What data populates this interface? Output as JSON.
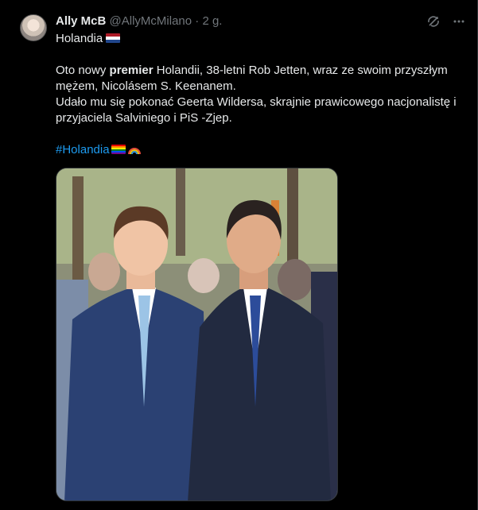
{
  "post": {
    "author_name": "Ally McB",
    "author_handle": "@AllyMcMilano",
    "time": "· 2 g.",
    "title": "Holandia",
    "line1_pre": "Oto nowy ",
    "line1_bold": "premier",
    "line1_post": " Holandii, 38-letni Rob Jetten, wraz ze swoim przyszłym mężem, Nicolásem S. Keenanem.",
    "line2": "Udało mu się pokonać Geerta Wildersa, skrajnie prawicowego nacjonalistę i przyjaciela Salviniego i PiS -Zjep.",
    "hashtag": "#Holandia"
  },
  "icons": {
    "avatar": "avatar",
    "grok": "grok-icon",
    "more": "more-icon",
    "flag_netherlands": "netherlands-flag-icon",
    "flag_rainbow": "rainbow-flag-icon",
    "rainbow": "rainbow-icon"
  },
  "colors": {
    "background": "#000000",
    "text": "#e7e9ea",
    "muted": "#71767b",
    "link": "#1d9bf0"
  }
}
